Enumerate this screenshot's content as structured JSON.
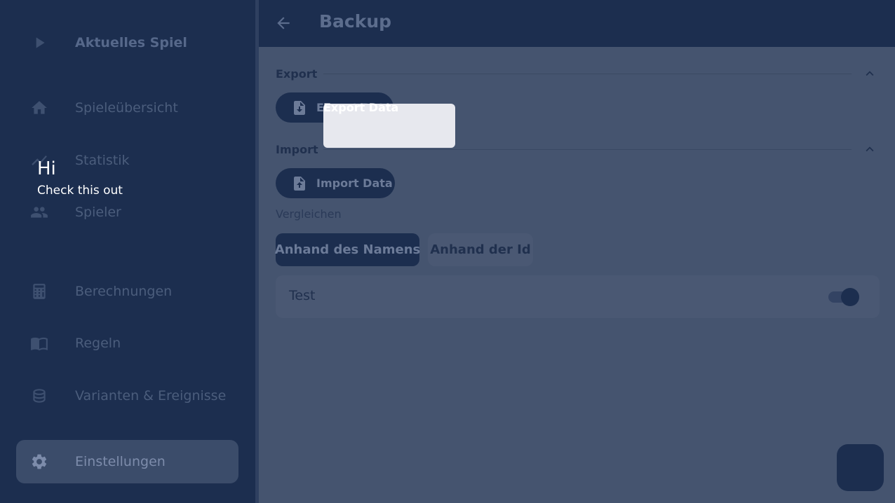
{
  "sidebar": {
    "items": [
      {
        "label": "Aktuelles Spiel",
        "icon": "play-icon"
      },
      {
        "label": "Spieleübersicht",
        "icon": "home-icon"
      },
      {
        "label": "Statistik",
        "icon": "chart-icon"
      },
      {
        "label": "Spieler",
        "icon": "people-icon"
      },
      {
        "label": "Berechnungen",
        "icon": "calculator-icon"
      },
      {
        "label": "Regeln",
        "icon": "book-icon"
      },
      {
        "label": "Varianten & Ereignisse",
        "icon": "database-icon"
      },
      {
        "label": "Einstellungen",
        "icon": "gear-icon"
      }
    ]
  },
  "tour": {
    "title": "Hi",
    "text": "Check this out"
  },
  "header": {
    "title": "Backup"
  },
  "export": {
    "section_title": "Export",
    "button_label": "Export Data",
    "spot_label": "Export Data"
  },
  "import": {
    "section_title": "Import",
    "button_label": "Import Data",
    "compare_label": "Vergleichen",
    "by_name": "Anhand des Namens",
    "by_id": "Anhand der Id",
    "test_label": "Test",
    "test_enabled": true
  },
  "colors": {
    "sidebar_bg": "#1c2e4f",
    "main_bg": "#45546f",
    "highlight": "#e7e8ee"
  }
}
